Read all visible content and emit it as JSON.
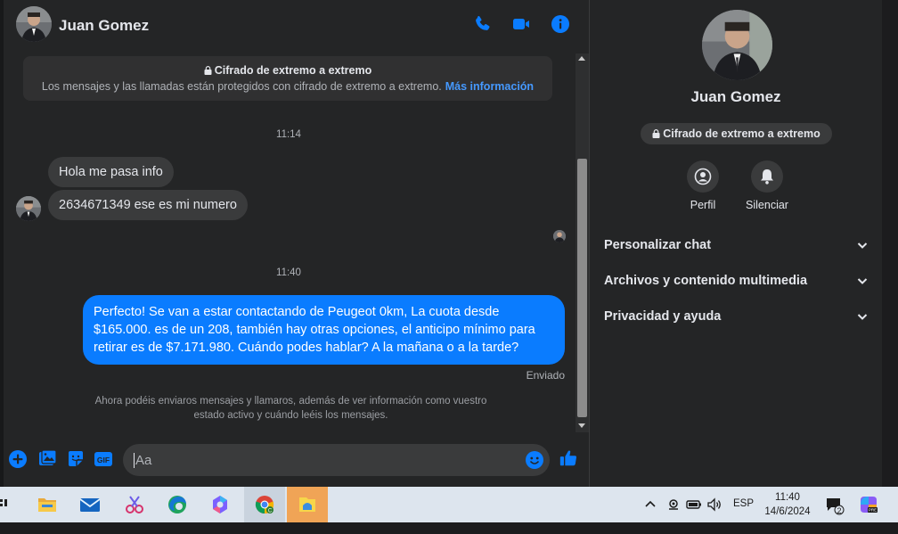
{
  "contact": {
    "name": "Juan Gomez"
  },
  "header_icons": [
    "phone-icon",
    "video-camera-icon",
    "info-icon"
  ],
  "encryption_banner": {
    "title": "Cifrado de extremo a extremo",
    "text": "Los mensajes y las llamadas están protegidos con cifrado de extremo a extremo.",
    "link": "Más información"
  },
  "messages": {
    "time1": "11:14",
    "incoming1": "Hola me pasa info",
    "incoming2": "2634671349 ese es mi numero",
    "time2": "11:40",
    "outgoing1": "Perfecto!  Se van a estar contactando de Peugeot 0km, La cuota desde $165.000. es de un 208, también hay otras opciones, el anticipo mínimo para retirar es de $7.171.980. Cuándo podes hablar? A la mañana o a la tarde?",
    "status": "Enviado",
    "notice": "Ahora podéis enviaros mensajes y llamaros, además de ver información como vuestro estado activo y cuándo leéis los mensajes."
  },
  "composer": {
    "placeholder": "Aa",
    "icons": [
      "plus-icon",
      "image-icon",
      "sticker-icon",
      "gif-icon",
      "emoji-icon",
      "like-icon"
    ],
    "gif_label": "GIF"
  },
  "info_panel": {
    "name": "Juan Gomez",
    "encryption_pill": "Cifrado de extremo a extremo",
    "actions": [
      {
        "label": "Perfil",
        "icon": "profile-icon"
      },
      {
        "label": "Silenciar",
        "icon": "bell-icon"
      }
    ],
    "sections": [
      {
        "label": "Personalizar chat"
      },
      {
        "label": "Archivos y contenido multimedia"
      },
      {
        "label": "Privacidad y ayuda"
      }
    ]
  },
  "taskbar": {
    "apps": [
      "file-explorer-icon",
      "mail-icon",
      "snipping-tool-icon",
      "edge-icon",
      "copilot-icon",
      "chrome-icon",
      "folder-app-icon"
    ],
    "language": "ESP",
    "time": "11:40",
    "date": "14/6/2024",
    "notification_count": "2"
  },
  "colors": {
    "accent": "#0a7cff",
    "background": "#242526",
    "bubble_in": "#3a3b3c",
    "taskbar": "#dde5ee",
    "active_app": "#f0a456"
  }
}
